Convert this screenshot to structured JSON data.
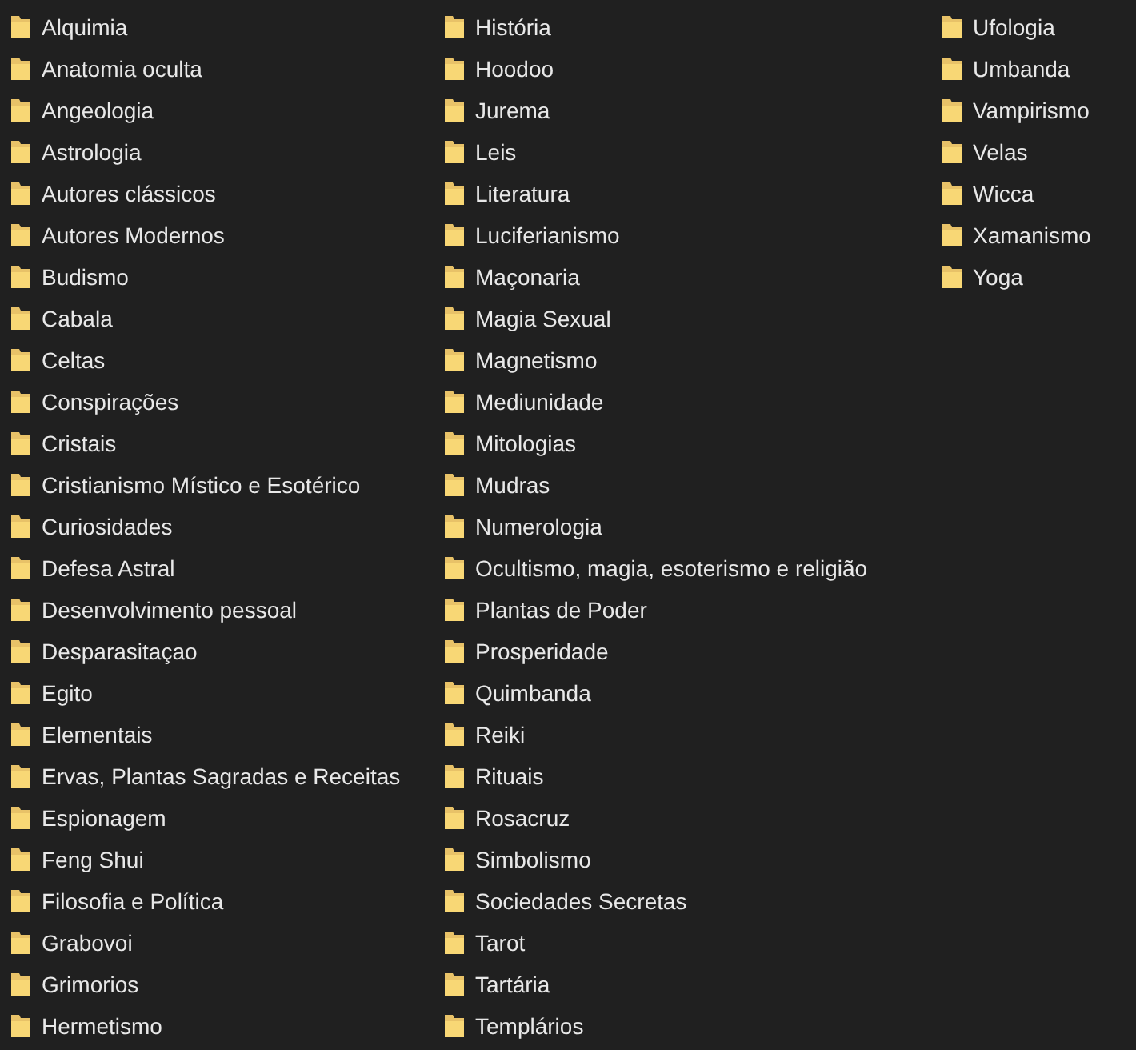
{
  "columns": [
    {
      "folders": [
        "Alquimia",
        "Anatomia oculta",
        "Angeologia",
        "Astrologia",
        "Autores clássicos",
        "Autores Modernos",
        "Budismo",
        "Cabala",
        "Celtas",
        "Conspirações",
        "Cristais",
        "Cristianismo Místico e Esotérico",
        "Curiosidades",
        "Defesa Astral",
        "Desenvolvimento pessoal",
        "Desparasitaçao",
        "Egito",
        "Elementais",
        "Ervas, Plantas Sagradas e Receitas",
        "Espionagem",
        "Feng Shui",
        "Filosofia e Política",
        "Grabovoi",
        "Grimorios",
        "Hermetismo"
      ]
    },
    {
      "folders": [
        "História",
        "Hoodoo",
        "Jurema",
        "Leis",
        "Literatura",
        "Luciferianismo",
        "Maçonaria",
        "Magia Sexual",
        "Magnetismo",
        "Mediunidade",
        "Mitologias",
        "Mudras",
        "Numerologia",
        "Ocultismo, magia, esoterismo e religião",
        "Plantas de Poder",
        "Prosperidade",
        "Quimbanda",
        "Reiki",
        "Rituais",
        "Rosacruz",
        "Simbolismo",
        "Sociedades Secretas",
        "Tarot",
        "Tartária",
        "Templários"
      ]
    },
    {
      "folders": [
        "Ufologia",
        "Umbanda",
        "Vampirismo",
        "Velas",
        "Wicca",
        "Xamanismo",
        "Yoga"
      ]
    }
  ]
}
